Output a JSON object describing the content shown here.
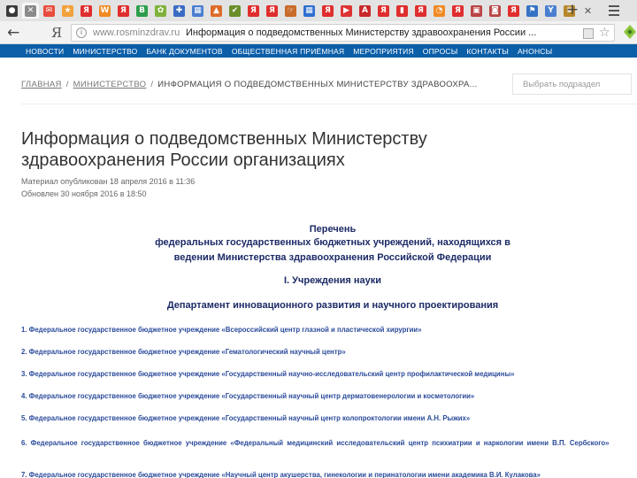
{
  "browser": {
    "tabs": [
      {
        "name": "tab-app",
        "glyph": "●",
        "color": "#3a3a3a"
      },
      {
        "name": "tab-active",
        "glyph": "✕",
        "color": "#ffffff",
        "active": true
      },
      {
        "name": "tab-mail",
        "glyph": "✉",
        "color": "#e94b3c"
      },
      {
        "name": "tab-bookmark",
        "glyph": "★",
        "color": "#f1a23a"
      },
      {
        "name": "tab-yandex",
        "glyph": "Я",
        "color": "#e02d2d"
      },
      {
        "name": "tab-orange",
        "glyph": "W",
        "color": "#f08a24"
      },
      {
        "name": "tab-yandex",
        "glyph": "Я",
        "color": "#e02d2d"
      },
      {
        "name": "tab-green",
        "glyph": "B",
        "color": "#2e9d4b"
      },
      {
        "name": "tab-leaf",
        "glyph": "✿",
        "color": "#7fb23a"
      },
      {
        "name": "tab-people",
        "glyph": "✚",
        "color": "#3b6bc4"
      },
      {
        "name": "tab-grid",
        "glyph": "▦",
        "color": "#4a7ed1"
      },
      {
        "name": "tab-chart",
        "glyph": "▲",
        "color": "#dd6c2a"
      },
      {
        "name": "tab-check",
        "glyph": "✔",
        "color": "#6a8f2a"
      },
      {
        "name": "tab-yandex",
        "glyph": "Я",
        "color": "#e02d2d"
      },
      {
        "name": "tab-yandex",
        "glyph": "Я",
        "color": "#e02d2d"
      },
      {
        "name": "tab-hand",
        "glyph": "☞",
        "color": "#c76a2a"
      },
      {
        "name": "tab-grid",
        "glyph": "▦",
        "color": "#2f6fd1"
      },
      {
        "name": "tab-yandex",
        "glyph": "Я",
        "color": "#e02d2d"
      },
      {
        "name": "tab-red",
        "glyph": "▶",
        "color": "#d33"
      },
      {
        "name": "tab-pdf",
        "glyph": "A",
        "color": "#c8282a"
      },
      {
        "name": "tab-yandex",
        "glyph": "Я",
        "color": "#e02d2d"
      },
      {
        "name": "tab-bars",
        "glyph": "▮",
        "color": "#e02d2d"
      },
      {
        "name": "tab-yandex",
        "glyph": "Я",
        "color": "#e02d2d"
      },
      {
        "name": "tab-orange",
        "glyph": "◔",
        "color": "#f08a24"
      },
      {
        "name": "tab-yandex",
        "glyph": "Я",
        "color": "#e02d2d"
      },
      {
        "name": "tab-box",
        "glyph": "▣",
        "color": "#b44"
      },
      {
        "name": "tab-box",
        "glyph": "◙",
        "color": "#b44"
      },
      {
        "name": "tab-yandex",
        "glyph": "Я",
        "color": "#e02d2d"
      },
      {
        "name": "tab-flag",
        "glyph": "⚑",
        "color": "#3572c4"
      },
      {
        "name": "tab-y",
        "glyph": "Y",
        "color": "#4a7ed1"
      },
      {
        "name": "tab-emblem",
        "glyph": "♛",
        "color": "#b8862b"
      },
      {
        "name": "tab-close",
        "glyph": "✕",
        "color": "transparent"
      }
    ],
    "new_tab_glyph": "+",
    "back_glyph": "←",
    "yandex_glyph": "Я",
    "url_domain": "www.rosminzdrav.ru",
    "page_title": "Информация о подведомственных Министерству здравоохранения России ..."
  },
  "nav": {
    "items": [
      "НОВОСТИ",
      "МИНИСТЕРСТВО",
      "БАНК ДОКУМЕНТОВ",
      "ОБЩЕСТВЕННАЯ ПРИЁМНАЯ",
      "МЕРОПРИЯТИЯ",
      "ОПРОСЫ",
      "КОНТАКТЫ",
      "АНОНСЫ"
    ]
  },
  "breadcrumb": {
    "home": "ГЛАВНАЯ",
    "ministry": "МИНИСТЕРСТВО",
    "separator": "/",
    "current": "ИНФОРМАЦИЯ О ПОДВЕДОМСТВЕННЫХ МИНИСТЕРСТВУ ЗДРАВООХРА..."
  },
  "section_select": {
    "placeholder": "Выбрать подраздел"
  },
  "page": {
    "title": "Информация о подведомственных Министерству здравоохранения России организациях",
    "published": "Материал опубликован 18 апреля 2016 в 11:36",
    "updated": "Обновлен 30 ноября 2016 в 18:50"
  },
  "document": {
    "list_title": "Перечень",
    "subtitle_line1": "федеральных государственных бюджетных учреждений, находящихся в",
    "subtitle_line2": "ведении Министерства здравоохранения Российской Федерации",
    "section": "I. Учреждения науки",
    "department": "Департамент инновационного развития и научного проектирования",
    "items": [
      "1. Федеральное государственное бюджетное учреждение «Всероссийский центр глазной и пластической хирургии»",
      "2. Федеральное государственное бюджетное учреждение «Гематологический научный центр»",
      "3. Федеральное государственное бюджетное учреждение «Государственный научно-исследовательский центр профилактической медицины»",
      "4. Федеральное государственное бюджетное учреждение «Государственный научный центр дерматовенерологии и косметологии»",
      "5. Федеральное государственное бюджетное учреждение «Государственный научный центр колопроктологии имени А.Н. Рыжих»",
      "6. Федеральное государственное бюджетное учреждение «Федеральный медицинский исследовательский центр психиатрии и наркологии имени В.П. Сербского»",
      "7. Федеральное государственное бюджетное учреждение «Научный центр акушерства, гинекологии и перинатологии имени академика В.И. Кулакова»"
    ]
  }
}
